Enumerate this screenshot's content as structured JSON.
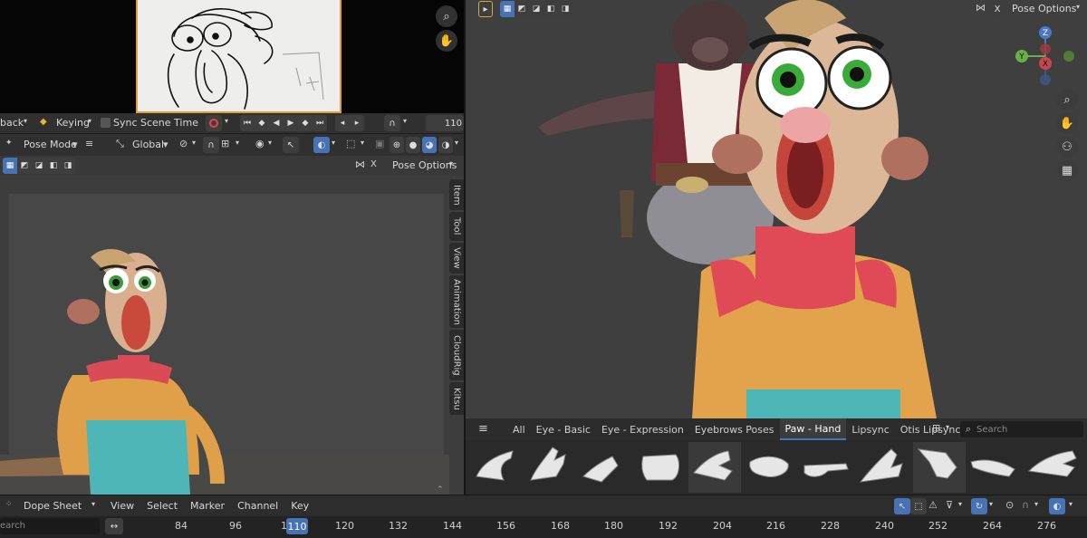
{
  "playback": {
    "playback_label": "back",
    "keying_label": "Keying",
    "sync_label": "Sync Scene Time",
    "current_frame": "110"
  },
  "left_viewport": {
    "mode_label": "Pose Mode",
    "orientation_label": "Global",
    "pose_options_label": "Pose Options",
    "sidebar_tabs": [
      "Item",
      "Tool",
      "View",
      "Animation",
      "CloudRig",
      "Kitsu"
    ]
  },
  "right_viewport": {
    "pose_options_label": "Pose Options",
    "close_label": "X",
    "left_close_label": "X"
  },
  "gizmo": {
    "z_label": "Z",
    "y_label": "Y",
    "x_label": "X"
  },
  "asset_shelf": {
    "tabs": [
      "All",
      "Eye - Basic",
      "Eye - Expression",
      "Eyebrows Poses",
      "Paw - Hand",
      "Lipsync",
      "Otis Lipsync"
    ],
    "active_tab": "Paw - Hand",
    "search_placeholder": "Search",
    "thumbnail_count_label": "11"
  },
  "dope_sheet": {
    "editor_label": "Dope Sheet",
    "menus": [
      "View",
      "Select",
      "Marker",
      "Channel",
      "Key"
    ],
    "search_placeholder": "earch",
    "current_frame": "110",
    "ticks": [
      "84",
      "96",
      "1",
      "120",
      "132",
      "144",
      "156",
      "168",
      "180",
      "192",
      "204",
      "216",
      "228",
      "240",
      "252",
      "264",
      "276"
    ]
  },
  "colors": {
    "accent": "#4772b3",
    "frame_border": "#e29a3a",
    "record": "#e04848"
  }
}
